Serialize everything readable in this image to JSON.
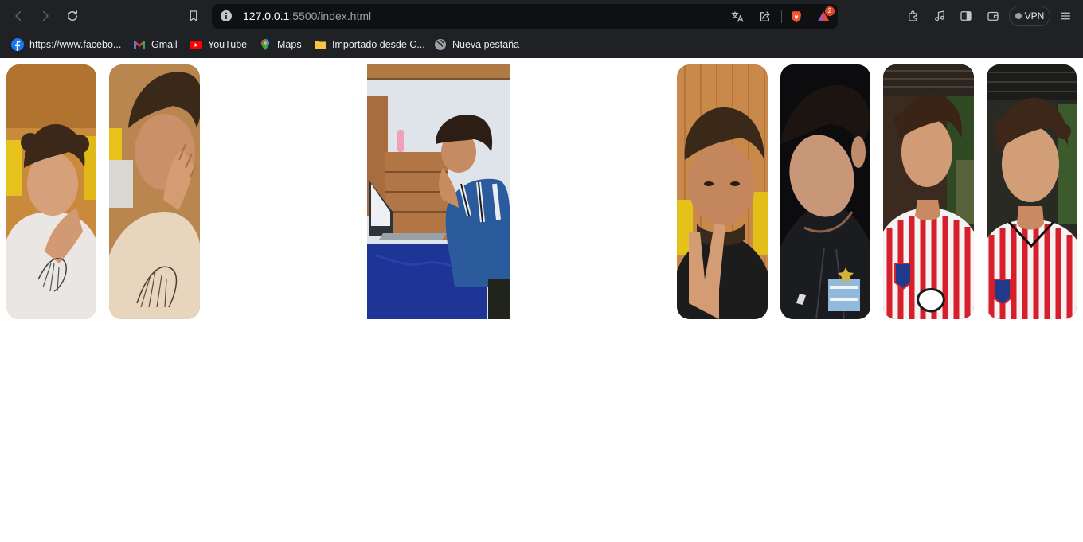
{
  "browser": {
    "url_host": "127.0.0.1",
    "url_rest": ":5500/index.html",
    "notification_count": "2",
    "vpn_label": "VPN"
  },
  "bookmarks": [
    {
      "label": "https://www.facebo...",
      "icon": "facebook-icon"
    },
    {
      "label": "Gmail",
      "icon": "gmail-icon"
    },
    {
      "label": "YouTube",
      "icon": "youtube-icon"
    },
    {
      "label": "Maps",
      "icon": "maps-icon"
    },
    {
      "label": "Importado desde C...",
      "icon": "folder-icon"
    },
    {
      "label": "Nueva pestaña",
      "icon": "globe-icon"
    }
  ],
  "gallery": {
    "photos": [
      {
        "name": "photo-laughing-white-hoodie",
        "bg": "#c98a3c"
      },
      {
        "name": "photo-laughing-hand-face",
        "bg": "#b8864e"
      },
      {
        "name": "photo-desk-laptop",
        "bg": "#dfe3ea"
      },
      {
        "name": "photo-peace-sign",
        "bg": "#c8894b"
      },
      {
        "name": "photo-dark-argentina-jacket",
        "bg": "#0c0c0e"
      },
      {
        "name": "photo-red-striped-shirt-outdoor",
        "bg": "#3a2a20"
      },
      {
        "name": "photo-red-striped-shirt-closeup",
        "bg": "#2a2a24"
      }
    ]
  }
}
